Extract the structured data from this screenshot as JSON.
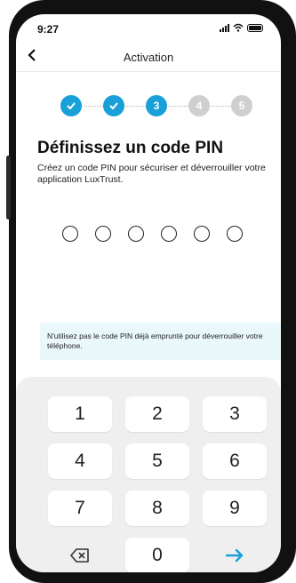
{
  "status_bar": {
    "time": "9:27"
  },
  "header": {
    "title": "Activation"
  },
  "stepper": {
    "steps": [
      "✓",
      "✓",
      "3",
      "4",
      "5"
    ]
  },
  "content": {
    "heading": "Définissez un code PIN",
    "description": "Créez un code PIN pour sécuriser et déverrouiller votre application LuxTrust.",
    "pin_length": 6,
    "info": "N'utilisez pas le code PIN déjà emprunté pour déverrouiller votre téléphone."
  },
  "keypad": {
    "keys": [
      "1",
      "2",
      "3",
      "4",
      "5",
      "6",
      "7",
      "8",
      "9"
    ],
    "zero": "0"
  },
  "colors": {
    "accent": "#1aa0d8",
    "pending": "#cfcfcf",
    "info_bg": "#eaf7fb",
    "keypad_bg": "#efefef"
  },
  "icons": {
    "back": "chevron-left-icon",
    "delete": "backspace-icon",
    "submit": "arrow-right-icon"
  }
}
